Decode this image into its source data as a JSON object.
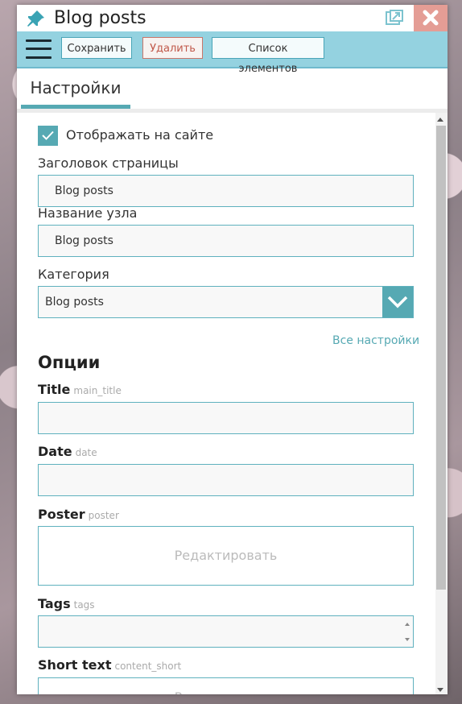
{
  "window": {
    "title": "Blog posts"
  },
  "toolbar": {
    "save_label": "Сохранить",
    "delete_label": "Удалить",
    "list_label": "Список элементов"
  },
  "tabs": [
    {
      "label": "Настройки",
      "active": true
    }
  ],
  "settings": {
    "show_on_site_label": "Отображать на сайте",
    "show_on_site_checked": true,
    "page_title_label": "Заголовок страницы",
    "page_title_value": "Blog posts",
    "node_name_label": "Название узла",
    "node_name_value": "Blog posts",
    "category_label": "Категория",
    "category_value": "Blog posts",
    "all_settings_link": "Все настройки"
  },
  "options": {
    "title": "Опции",
    "fields": [
      {
        "label": "Title",
        "key": "main_title",
        "value": ""
      },
      {
        "label": "Date",
        "key": "date",
        "value": ""
      },
      {
        "label": "Poster",
        "key": "poster",
        "action": "Редактировать"
      },
      {
        "label": "Tags",
        "key": "tags",
        "value": ""
      },
      {
        "label": "Short text",
        "key": "content_short",
        "action": "Редактировать"
      }
    ]
  },
  "colors": {
    "accent": "#56a9b3",
    "toolbar": "#94d2e0",
    "close": "#e49d95",
    "delete": "#c0584a"
  },
  "icons": [
    "pin-icon",
    "detach-icon",
    "close-icon",
    "menu-icon",
    "check-icon",
    "chevron-down-icon"
  ]
}
